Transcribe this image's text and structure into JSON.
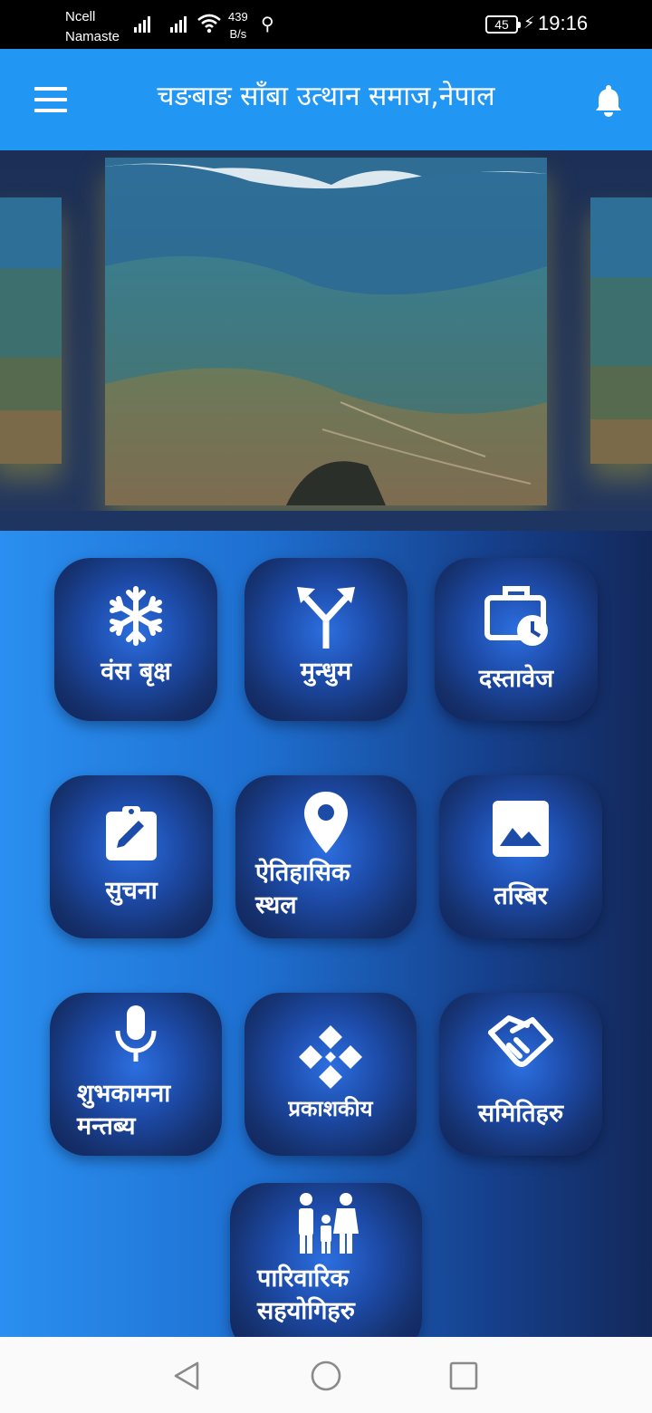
{
  "status_bar": {
    "carrier_primary": "Ncell",
    "carrier_secondary": "Namaste",
    "net_speed_value": "439",
    "net_speed_unit": "B/s",
    "battery_level": "45",
    "time": "19:16"
  },
  "app_bar": {
    "title": "चङबाङ साँबा उत्थान समाज,नेपाल",
    "menu_icon": "hamburger-menu-icon",
    "notification_icon": "bell-icon",
    "background_color": "#2196f3"
  },
  "carousel": {
    "slides": [
      "slide-left-partial",
      "slide-center",
      "slide-right-partial"
    ]
  },
  "menu_tiles": [
    {
      "label": "वंस बृक्ष",
      "icon": "snowflake-icon"
    },
    {
      "label": "मुन्धुम",
      "icon": "fork-arrows-icon"
    },
    {
      "label": "दस्तावेज",
      "icon": "briefcase-clock-icon"
    },
    {
      "label": "सुचना",
      "icon": "clipboard-edit-icon"
    },
    {
      "label": "ऐतिहासिक\nस्थल",
      "icon": "location-pin-icon"
    },
    {
      "label": "तस्बिर",
      "icon": "image-icon"
    },
    {
      "label": "शुभकामना\nमन्तब्य",
      "icon": "microphone-icon"
    },
    {
      "label": "प्रकाशकीय",
      "icon": "diamond-pattern-icon"
    },
    {
      "label": "समितिहरु",
      "icon": "handshake-icon"
    },
    {
      "label": "पारिवारिक\nसहयोगिहरु",
      "icon": "family-icon"
    }
  ],
  "nav_bar": {
    "back_icon": "back-triangle-icon",
    "home_icon": "home-circle-icon",
    "recents_icon": "recents-square-icon"
  }
}
